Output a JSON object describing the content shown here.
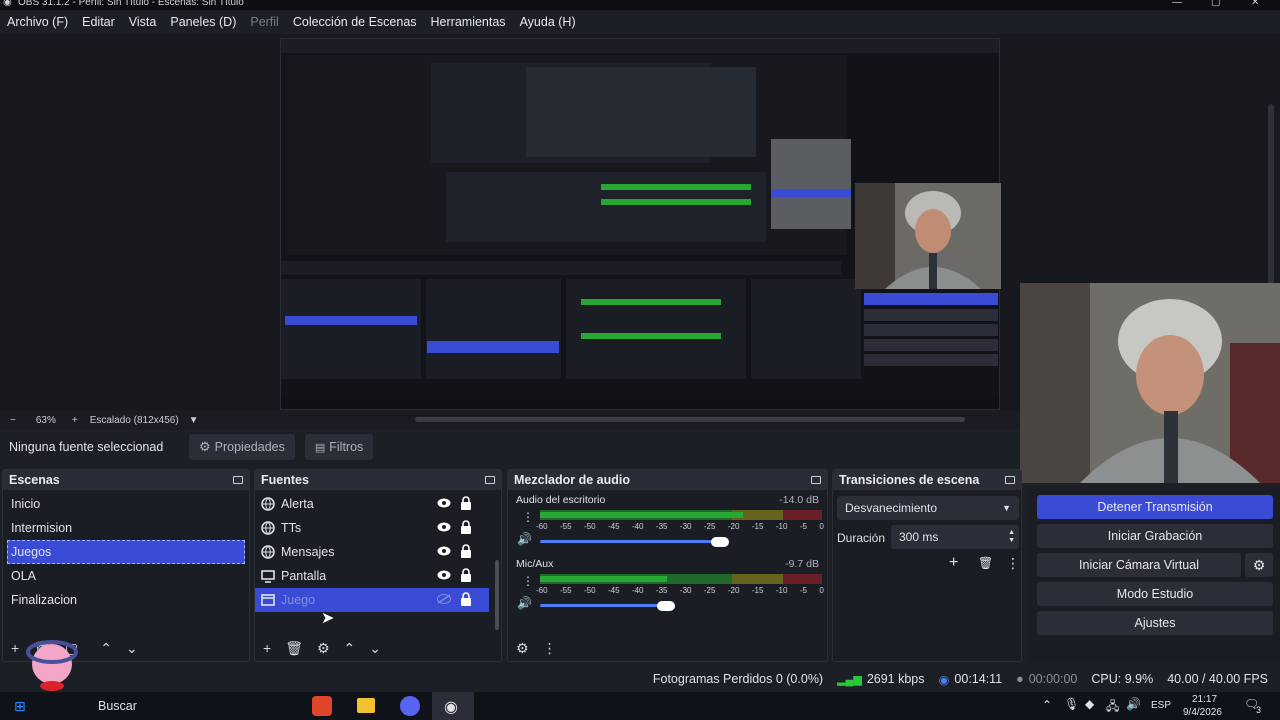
{
  "window": {
    "title": "OBS 31.1.2 - Perfil: Sin Título - Escenas: Sin Título"
  },
  "menu": [
    {
      "label": "Archivo (F)",
      "enabled": true
    },
    {
      "label": "Editar",
      "enabled": true
    },
    {
      "label": "Vista",
      "enabled": true
    },
    {
      "label": "Paneles (D)",
      "enabled": true
    },
    {
      "label": "Perfil",
      "enabled": false
    },
    {
      "label": "Colección de Escenas",
      "enabled": true
    },
    {
      "label": "Herramientas",
      "enabled": true
    },
    {
      "label": "Ayuda (H)",
      "enabled": true
    }
  ],
  "zoom": {
    "minus": "−",
    "percent": "63%",
    "plus": "+",
    "scale_label": "Escalado (812x456)"
  },
  "context": {
    "no_source": "Ninguna fuente seleccionad",
    "properties": "Propiedades",
    "filters": "Filtros"
  },
  "scenes": {
    "title": "Escenas",
    "items": [
      "Inicio",
      "Intermision",
      "Juegos",
      "OLA",
      "Finalizacion"
    ],
    "selected_index": 2
  },
  "sources": {
    "title": "Fuentes",
    "items": [
      {
        "label": "Alerta",
        "icon": "browser-icon",
        "visible": true
      },
      {
        "label": "TTs",
        "icon": "browser-icon",
        "visible": true
      },
      {
        "label": "Mensajes",
        "icon": "browser-icon",
        "visible": true
      },
      {
        "label": "Pantalla",
        "icon": "monitor-icon",
        "visible": true
      },
      {
        "label": "Juego",
        "icon": "window-icon",
        "visible": false
      }
    ],
    "selected_index": 4
  },
  "mixer": {
    "title": "Mezclador de audio",
    "channels": [
      {
        "name": "Audio del escritorio",
        "db": "-14.0 dB",
        "level": 0.72,
        "volume": 0.95
      },
      {
        "name": "Mic/Aux",
        "db": "-9.7 dB",
        "level": 0.45,
        "volume": 0.66
      }
    ],
    "ticks": [
      "-60",
      "-55",
      "-50",
      "-45",
      "-40",
      "-35",
      "-30",
      "-25",
      "-20",
      "-15",
      "-10",
      "-5",
      "0"
    ]
  },
  "transitions": {
    "title": "Transiciones de escena",
    "selected": "Desvanecimiento",
    "duration_label": "Duración",
    "duration_value": "300 ms"
  },
  "controls": {
    "stop_stream": "Detener Transmisión",
    "start_recording": "Iniciar Grabación",
    "virtual_cam": "Iniciar Cámara Virtual",
    "studio_mode": "Modo Estudio",
    "settings": "Ajustes"
  },
  "status": {
    "dropped": "Fotogramas Perdidos 0 (0.0%)",
    "bitrate": "2691 kbps",
    "stream_time": "00:14:11",
    "record_time": "00:00:00",
    "cpu": "CPU: 9.9%",
    "fps": "40.00 / 40.00 FPS"
  },
  "taskbar": {
    "search": "Buscar",
    "lang": "ESP",
    "time": "21:17",
    "date": "9/4/2026",
    "notifications": "3"
  },
  "colors": {
    "accent": "#3a4bd6",
    "panel": "#1b1d24",
    "meter_green": "#27a832",
    "meter_yellow": "#a89a1c",
    "meter_red": "#a8202a"
  }
}
